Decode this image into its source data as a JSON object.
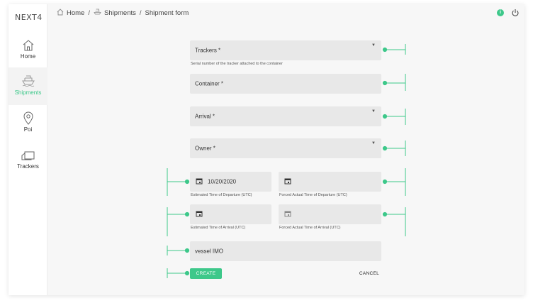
{
  "app": {
    "logo": "NEXT4"
  },
  "sidebar": {
    "items": [
      {
        "label": "Home",
        "icon": "home-icon",
        "active": false
      },
      {
        "label": "Shipments",
        "icon": "ship-icon",
        "active": true
      },
      {
        "label": "Poi",
        "icon": "map-pin-icon",
        "active": false
      },
      {
        "label": "Trackers",
        "icon": "tracker-icon",
        "active": false
      }
    ]
  },
  "breadcrumb": {
    "home": "Home",
    "shipments": "Shipments",
    "current": "Shipment form",
    "separator": "/"
  },
  "header": {
    "status_badge": "i"
  },
  "form": {
    "trackers": {
      "label": "Trackers *",
      "helper": "Serial number of the tracker attached to the container"
    },
    "container": {
      "label": "Container *"
    },
    "arrival": {
      "label": "Arrival *"
    },
    "owner": {
      "label": "Owner *"
    },
    "etd": {
      "value": "10/20/2020",
      "helper": "Estimated Time of Departure (UTC)"
    },
    "fatd": {
      "value": "",
      "helper": "Forced Actual Time of Departure (UTC)"
    },
    "eta": {
      "value": "",
      "helper": "Estimated Time of Arrival (UTC)"
    },
    "fata": {
      "value": "",
      "helper": "Forced Actual Time of Arrival (UTC)"
    },
    "vessel_imo": {
      "label": "vessel IMO"
    },
    "create_label": "CREATE",
    "cancel_label": "CANCEL"
  },
  "colors": {
    "accent": "#3dc88a",
    "field_bg": "#e8e8e8",
    "page_bg": "#f7f7f7"
  }
}
